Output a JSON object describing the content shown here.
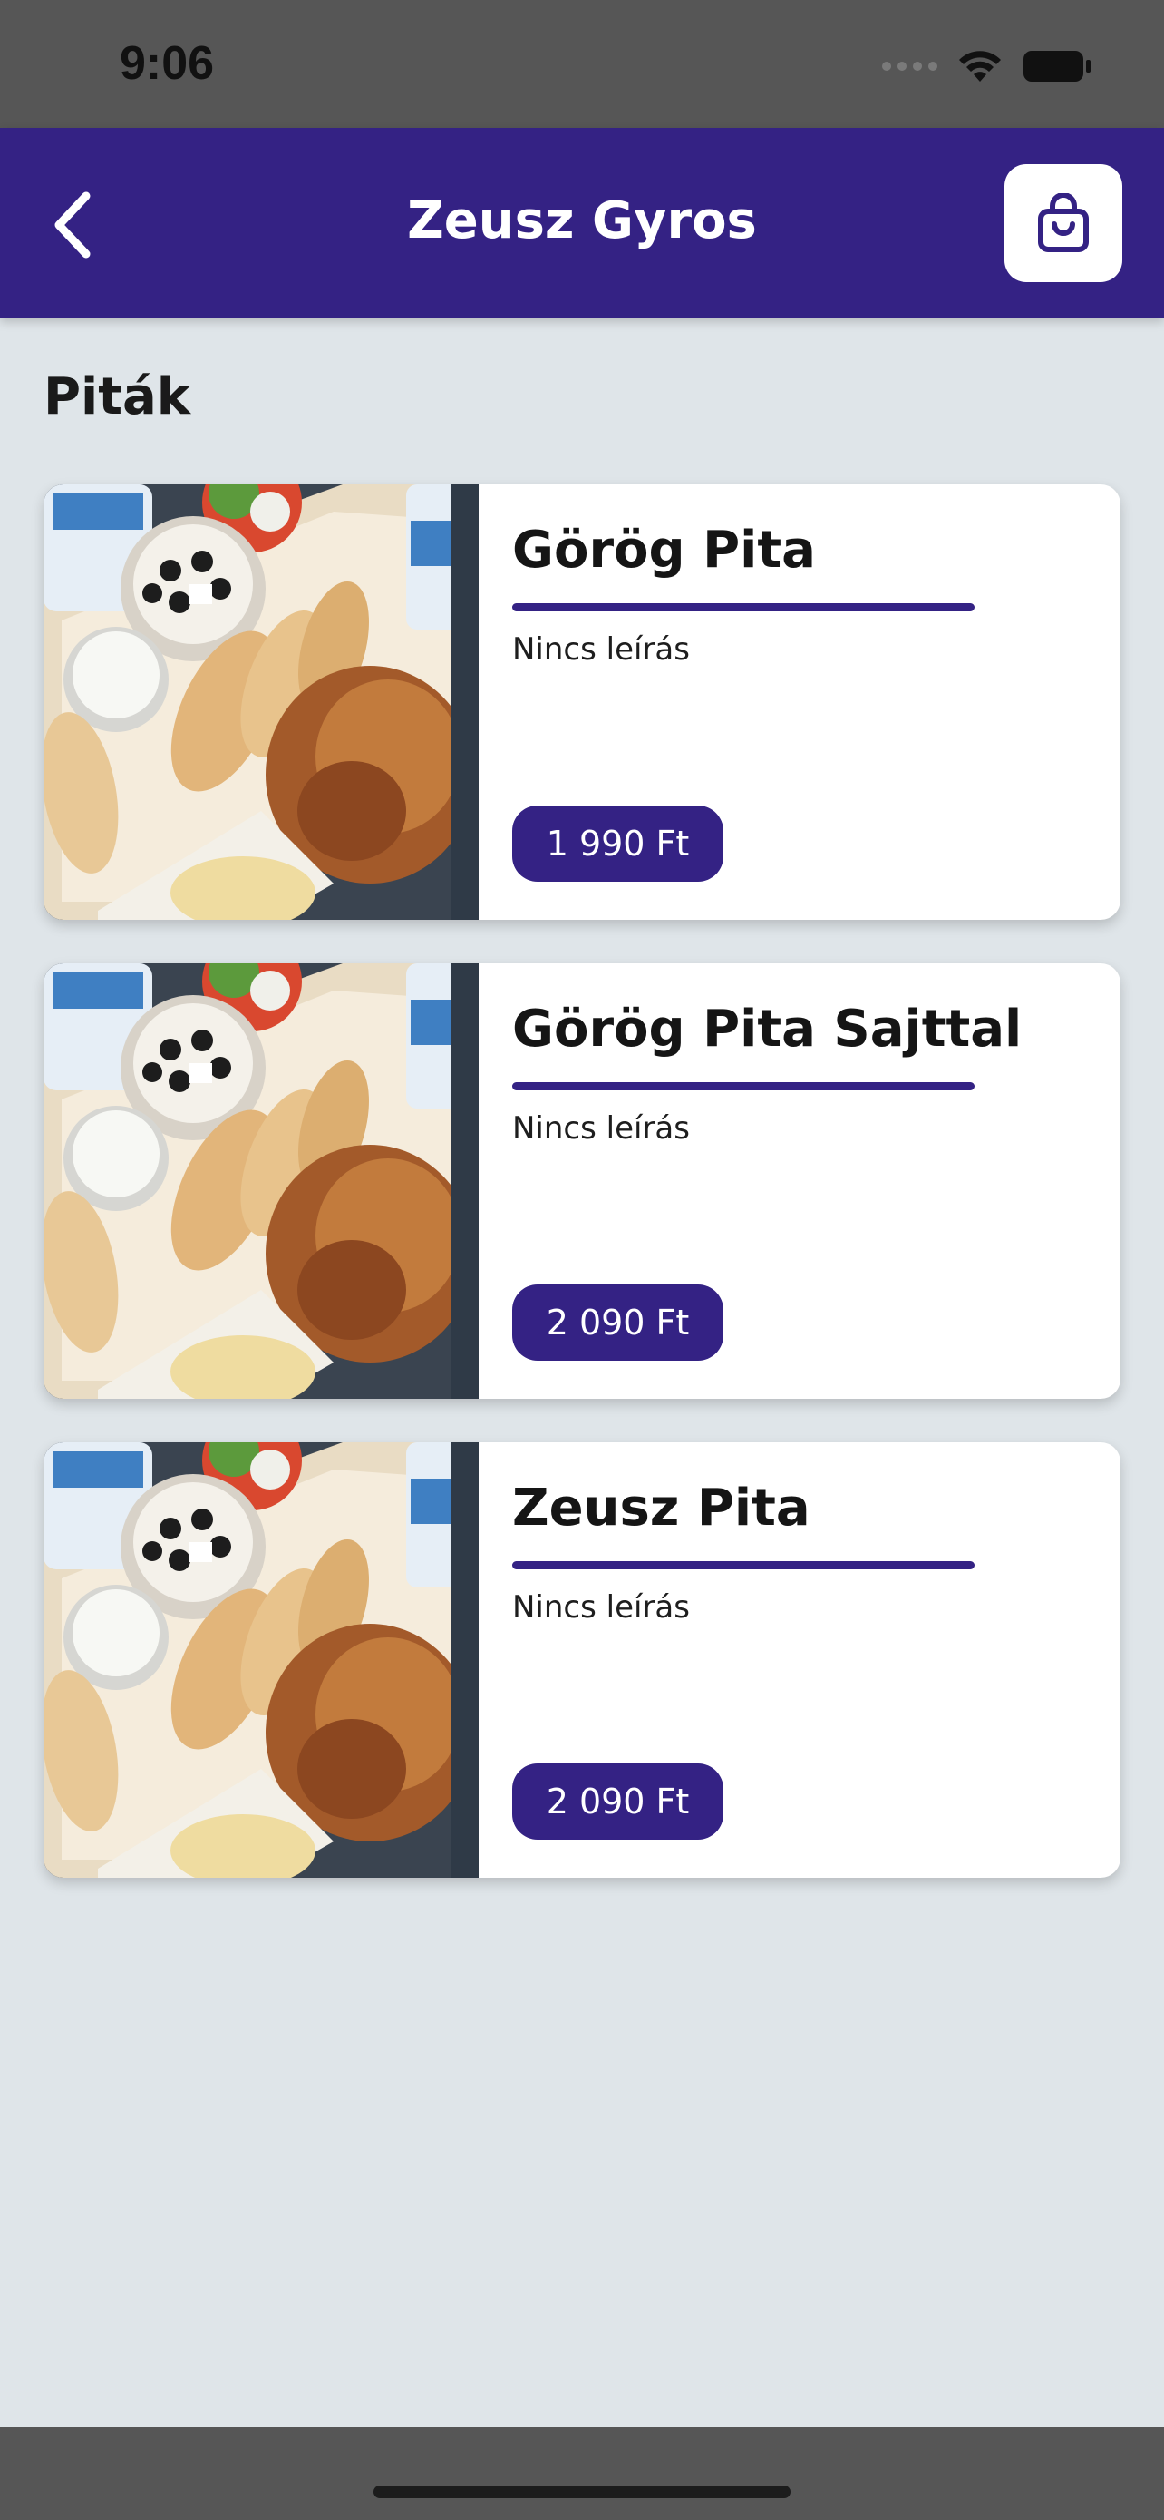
{
  "status_bar": {
    "time": "9:06"
  },
  "header": {
    "title": "Zeusz Gyros",
    "back_icon": "chevron-left-icon",
    "cart_icon": "shopping-bag-icon"
  },
  "section": {
    "title": "Piták"
  },
  "items": [
    {
      "name": "Görög Pita",
      "description": "Nincs leírás",
      "price": "1 990 Ft"
    },
    {
      "name": "Görög Pita Sajttal",
      "description": "Nincs leírás",
      "price": "2 090 Ft"
    },
    {
      "name": "Zeusz Pita",
      "description": "Nincs leírás",
      "price": "2 090 Ft"
    }
  ],
  "colors": {
    "primary": "#342284",
    "background": "#dfe5e9",
    "card": "#ffffff"
  }
}
